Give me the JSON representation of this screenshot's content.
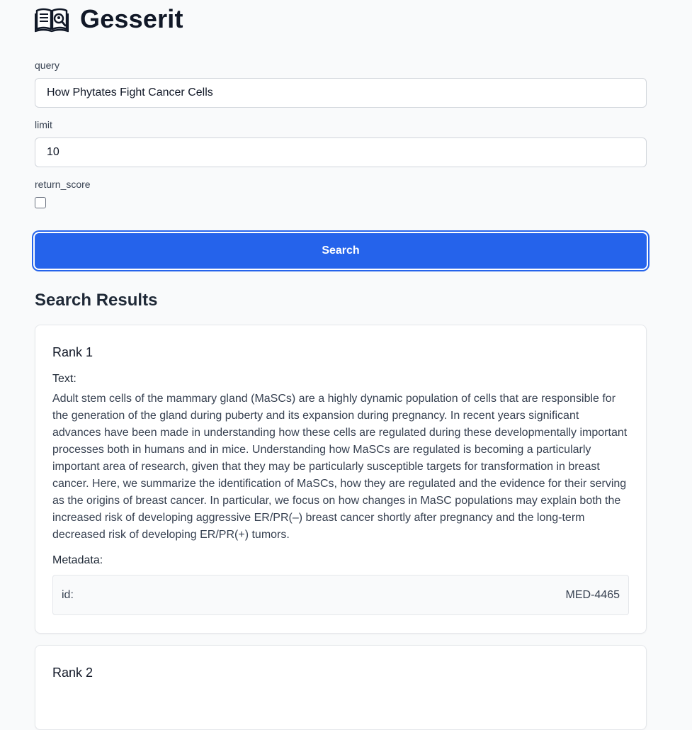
{
  "app": {
    "title": "Gesserit",
    "logo_icon": "book-magnifier-icon"
  },
  "form": {
    "query": {
      "label": "query",
      "value": "How Phytates Fight Cancer Cells"
    },
    "limit": {
      "label": "limit",
      "value": "10"
    },
    "return_score": {
      "label": "return_score",
      "checked": false
    },
    "search_button_label": "Search"
  },
  "results": {
    "heading": "Search Results",
    "text_label": "Text:",
    "metadata_label": "Metadata:",
    "items": [
      {
        "rank": "Rank 1",
        "text": "Adult stem cells of the mammary gland (MaSCs) are a highly dynamic population of cells that are responsible for the generation of the gland during puberty and its expansion during pregnancy. In recent years significant advances have been made in understanding how these cells are regulated during these developmentally important processes both in humans and in mice. Understanding how MaSCs are regulated is becoming a particularly important area of research, given that they may be particularly susceptible targets for transformation in breast cancer. Here, we summarize the identification of MaSCs, how they are regulated and the evidence for their serving as the origins of breast cancer. In particular, we focus on how changes in MaSC populations may explain both the increased risk of developing aggressive ER/PR(–) breast cancer shortly after pregnancy and the long-term decreased risk of developing ER/PR(+) tumors.",
        "metadata": {
          "key": "id:",
          "value": "MED-4465"
        }
      },
      {
        "rank": "Rank 2"
      }
    ]
  },
  "colors": {
    "accent": "#2563eb",
    "background": "#f9fafb",
    "card": "#ffffff",
    "border": "#e5e7eb"
  }
}
